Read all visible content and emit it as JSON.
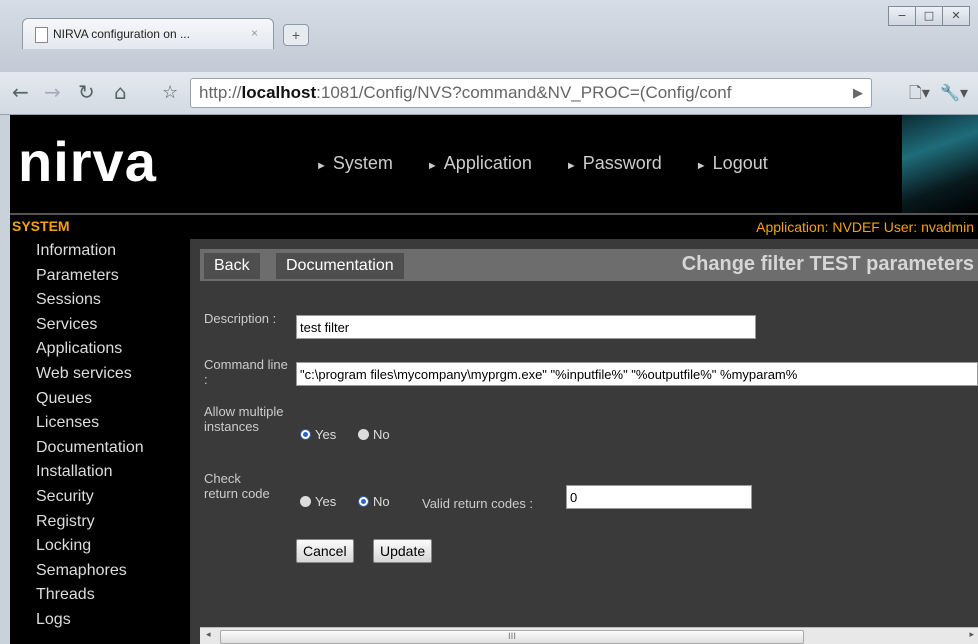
{
  "browser": {
    "tab_title": "NIRVA configuration on ...",
    "tab_close": "×",
    "new_tab": "+",
    "url_prefix": "http://",
    "url_host": "localhost",
    "url_rest": ":1081/Config/NVS?command&NV_PROC=(Config/conf",
    "window_buttons": [
      "−",
      "□",
      "✕"
    ]
  },
  "header": {
    "logo": "nirva",
    "menu": [
      "System",
      "Application",
      "Password",
      "Logout"
    ]
  },
  "statusbar": {
    "section": "SYSTEM",
    "info": "Application: NVDEF  User: nvadmin"
  },
  "sidebar": {
    "items": [
      "Information",
      "Parameters",
      "Sessions",
      "Services",
      "Applications",
      "Web services",
      "Queues",
      "Licenses",
      "Documentation",
      "Installation",
      "Security",
      "Registry",
      "Locking",
      "Semaphores",
      "Threads",
      "Logs"
    ]
  },
  "content": {
    "back_label": "Back",
    "doc_label": "Documentation",
    "heading": "Change filter TEST parameters",
    "description_label": "Description :",
    "description_value": "test filter",
    "command_label": "Command line :",
    "command_value": "\"c:\\program files\\mycompany\\myprgm.exe\" \"%inputfile%\" \"%outputfile%\" %myparam%",
    "multiple_label": "Allow multiple instances",
    "multiple_yes": "Yes",
    "multiple_no": "No",
    "multiple_selected": "Yes",
    "check_label": "Check return code",
    "check_yes": "Yes",
    "check_no": "No",
    "check_selected": "No",
    "valid_codes_label": "Valid return codes :",
    "valid_codes_value": "0",
    "cancel_label": "Cancel",
    "update_label": "Update"
  },
  "scrollbar": {
    "thumb_label": "III"
  }
}
